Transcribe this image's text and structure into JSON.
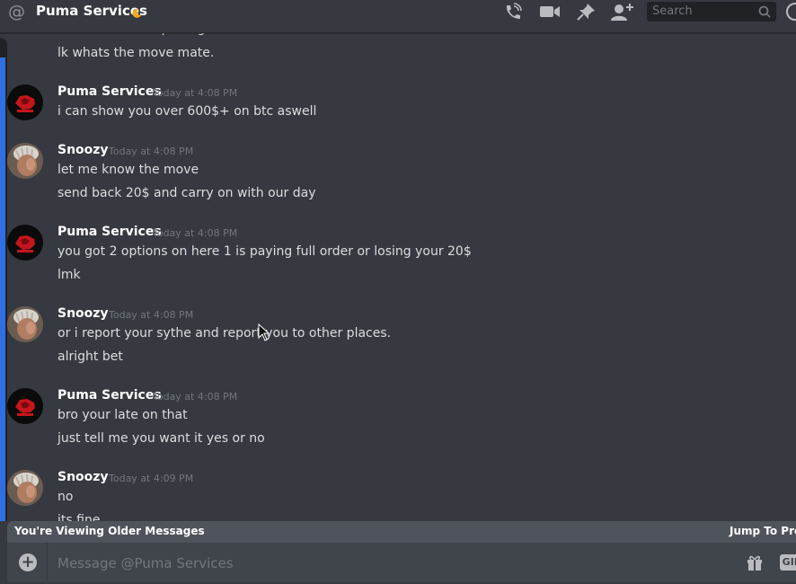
{
  "header": {
    "channel_title": "Puma Services",
    "search_placeholder": "Search"
  },
  "messages": [
    {
      "type": "continuation",
      "lines": [
        "and slice will help me get u banned.",
        "lk whats the move mate."
      ]
    },
    {
      "type": "group",
      "author": "Puma Services",
      "avatar": "puma-logo",
      "timestamp": "Today at 4:08 PM",
      "lines": [
        "i can show you over 600$+  on btc aswell"
      ]
    },
    {
      "type": "group",
      "author": "Snoozy",
      "avatar": "snoozy-photo",
      "timestamp": "Today at 4:08 PM",
      "lines": [
        "let me know the move",
        "send back 20$ and carry on with our day"
      ]
    },
    {
      "type": "group",
      "author": "Puma Services",
      "avatar": "puma-logo",
      "timestamp": "Today at 4:08 PM",
      "lines": [
        "you got 2 options on here 1 is paying full order or losing your 20$",
        "lmk"
      ]
    },
    {
      "type": "group",
      "author": "Snoozy",
      "avatar": "snoozy-photo",
      "timestamp": "Today at 4:08 PM",
      "lines": [
        "or i report your sythe and report you to other places.",
        "alright bet"
      ]
    },
    {
      "type": "group",
      "author": "Puma Services",
      "avatar": "puma-logo",
      "timestamp": "Today at 4:08 PM",
      "lines": [
        "bro your late on that",
        "just tell me you want it yes or no"
      ]
    },
    {
      "type": "group",
      "author": "Snoozy",
      "avatar": "snoozy-photo",
      "timestamp": "Today at 4:09 PM",
      "lines": [
        "no",
        "its fine"
      ]
    }
  ],
  "older_bar": {
    "label": "You're Viewing Older Messages",
    "jump_label": "Jump To Present"
  },
  "composer": {
    "placeholder": "Message @Puma Services",
    "gif_label": "GIF"
  },
  "colors": {
    "background": "#36393f",
    "composer": "#40444b",
    "accent_blue": "#2f6fe4",
    "username": "#ffffff",
    "timestamp": "#72767d"
  },
  "icons": [
    "at-icon",
    "moon-icon",
    "call-icon",
    "video-icon",
    "pin-icon",
    "add-friend-icon",
    "search-icon",
    "help-icon",
    "plus-icon",
    "gift-icon"
  ]
}
